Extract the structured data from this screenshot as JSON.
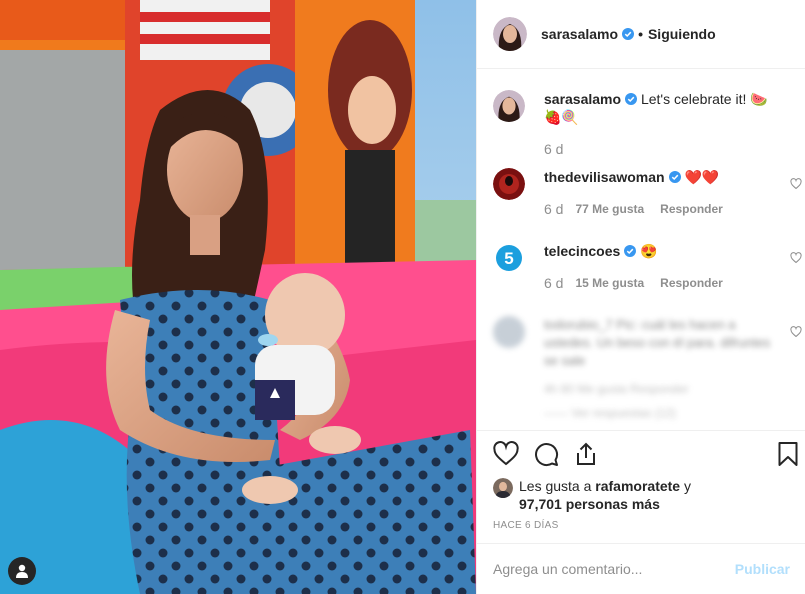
{
  "header": {
    "username": "sarasalamo",
    "separator": "•",
    "follow_status": "Siguiendo"
  },
  "caption": {
    "username": "sarasalamo",
    "text": "Let's celebrate it! 🍉🍓🍭",
    "time": "6 d"
  },
  "comments": [
    {
      "username": "thedevilisawoman",
      "text": "❤️❤️",
      "time": "6 d",
      "likes": "77 Me gusta",
      "reply": "Responder"
    },
    {
      "username": "telecincoes",
      "text": "😍",
      "time": "6 d",
      "likes": "15 Me gusta",
      "reply": "Responder"
    }
  ],
  "blurred_comment": {
    "text": "todorubio_7 Pic: cuál les hacen a ustedes. Un beso con él para. difruntes se sale",
    "meta_a": "4h   80 Me gusta   Responder",
    "meta_b": "—— Ver respuestas (12)"
  },
  "likes": {
    "prefix": "Les gusta a ",
    "user": "rafamoratete",
    "conjunction": " y",
    "count": "97,701 personas más"
  },
  "posted_ago": "HACE 6 DÍAS",
  "comment_input": {
    "placeholder": "Agrega un comentario..."
  },
  "publish_label": "Publicar",
  "icons": {
    "verified": "verified-badge-icon",
    "like": "heart-icon",
    "comment": "comment-bubble-icon",
    "share": "share-upload-icon",
    "save": "bookmark-icon",
    "tag": "user-tag-icon"
  },
  "colors": {
    "verified": "#3897f0",
    "text": "#262626",
    "secondary": "#8e8e8e",
    "border": "#efefef",
    "publish_disabled": "#b2dffc",
    "telecinco": "#1c9fde"
  }
}
